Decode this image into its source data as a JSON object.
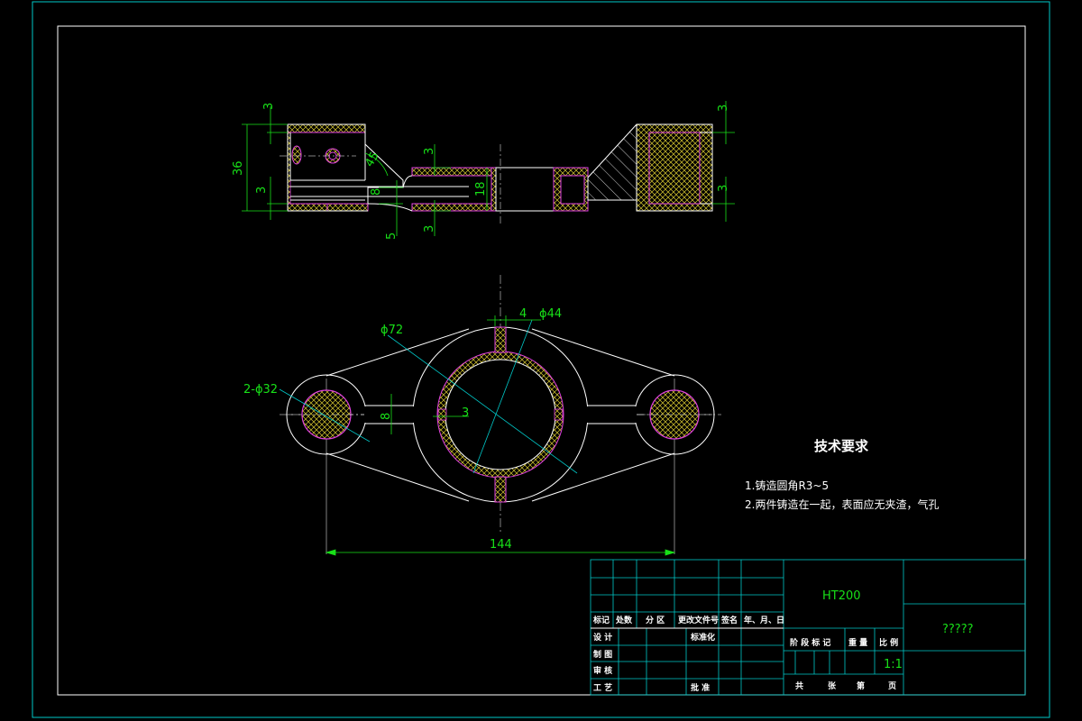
{
  "colors": {
    "background": "#000000",
    "frame": "#00c8c8",
    "outline": "#ffffff",
    "dimension": "#18e018",
    "hatch": "#d8c830",
    "section_edge": "#e040e0",
    "centerline": "#ffffff"
  },
  "front_view": {
    "dimensions": {
      "top_left_3": "3",
      "height_36": "36",
      "left_3": "3",
      "angle_45": "45",
      "width_8": "8",
      "bottom_5": "5",
      "mid_top_3": "3",
      "mid_bottom_3": "3",
      "height_18": "18",
      "right_top_3": "3",
      "right_bottom_3": "3"
    }
  },
  "top_view": {
    "dimensions": {
      "phi72": "ϕ72",
      "rib_4": "4",
      "phi44": "ϕ44",
      "holes_2x_phi32": "2-ϕ32",
      "arm_8": "8",
      "wall_3": "3",
      "length_144": "144"
    }
  },
  "technical_requirements": {
    "title": "技术要求",
    "items": [
      "1.铸造圆角R3~5",
      "2.两件铸造在一起，表面应无夹渣，气孔"
    ]
  },
  "title_block": {
    "material": "HT200",
    "drawing_name": "?????",
    "scale": "1:1",
    "rev_headers": [
      "标记",
      "处数",
      "分 区",
      "更改文件号",
      "签名",
      "年、月、日"
    ],
    "rows": {
      "design": "设 计",
      "standardize": "标准化",
      "draft": "制 图",
      "review": "审 核",
      "process": "工 艺",
      "approve": "批 准"
    },
    "stage_headers": [
      "阶 段 标 记",
      "重 量",
      "比 例"
    ],
    "sheet_labels": [
      "共",
      "张",
      "第",
      "页"
    ]
  }
}
